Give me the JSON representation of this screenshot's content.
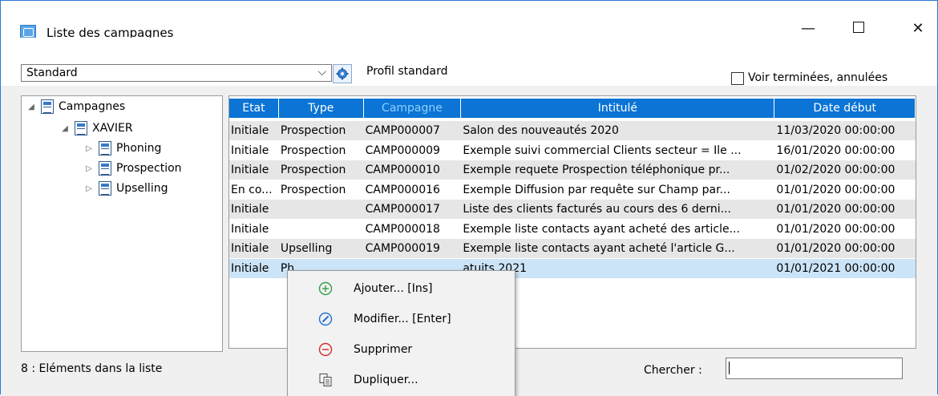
{
  "window": {
    "title": "Liste des campagnes",
    "minimize": "—",
    "close": "✕"
  },
  "toolbar": {
    "view_select": "Standard",
    "profile_label": "Profil standard",
    "show_finished_label": "Voir terminées, annulées",
    "show_finished_checked": false
  },
  "tree": {
    "root": "Campagnes",
    "child": "XAVIER",
    "items": [
      "Phoning",
      "Prospection",
      "Upselling"
    ]
  },
  "grid": {
    "columns": [
      "Etat",
      "Type",
      "Campagne",
      "Intitulé",
      "Date début"
    ],
    "sorted_column": "Campagne",
    "rows": [
      {
        "etat": "Initiale",
        "type": "Prospection",
        "campagne": "CAMP000007",
        "intitule": "Salon des nouveautés 2020",
        "date": "11/03/2020 00:00:00"
      },
      {
        "etat": "Initiale",
        "type": "Prospection",
        "campagne": "CAMP000009",
        "intitule": "Exemple suivi commercial Clients secteur = Ile ...",
        "date": "16/01/2020 00:00:00"
      },
      {
        "etat": "Initiale",
        "type": "Prospection",
        "campagne": "CAMP000010",
        "intitule": "Exemple requete Prospection téléphonique pr...",
        "date": "01/02/2020 00:00:00"
      },
      {
        "etat": "En co...",
        "type": "Prospection",
        "campagne": "CAMP000016",
        "intitule": "Exemple Diffusion par requête sur Champ par...",
        "date": "01/01/2020 00:00:00"
      },
      {
        "etat": "Initiale",
        "type": "",
        "campagne": "CAMP000017",
        "intitule": "Liste des clients facturés au cours des 6 derni...",
        "date": "01/01/2020 00:00:00"
      },
      {
        "etat": "Initiale",
        "type": "",
        "campagne": "CAMP000018",
        "intitule": "Exemple liste contacts ayant acheté des article...",
        "date": "01/01/2020 00:00:00"
      },
      {
        "etat": "Initiale",
        "type": "Upselling",
        "campagne": "CAMP000019",
        "intitule": "Exemple liste contacts ayant acheté l'article G...",
        "date": "01/01/2020 00:00:00"
      },
      {
        "etat": "Initiale",
        "type": "Ph",
        "campagne": "",
        "intitule": "atuits 2021",
        "date": "01/01/2021 00:00:00"
      }
    ]
  },
  "footer": {
    "count": "8 : Eléments dans la liste",
    "search_label": "Chercher :",
    "search_value": ""
  },
  "context_menu": {
    "items": [
      {
        "label": "Ajouter... [Ins]",
        "icon": "add-icon",
        "color": "#2ea043"
      },
      {
        "label": "Modifier... [Enter]",
        "icon": "edit-icon",
        "color": "#1f6fd0"
      },
      {
        "label": "Supprimer",
        "icon": "delete-icon",
        "color": "#d42a2a"
      },
      {
        "label": "Dupliquer...",
        "icon": "duplicate-icon",
        "color": "#444444"
      }
    ]
  }
}
